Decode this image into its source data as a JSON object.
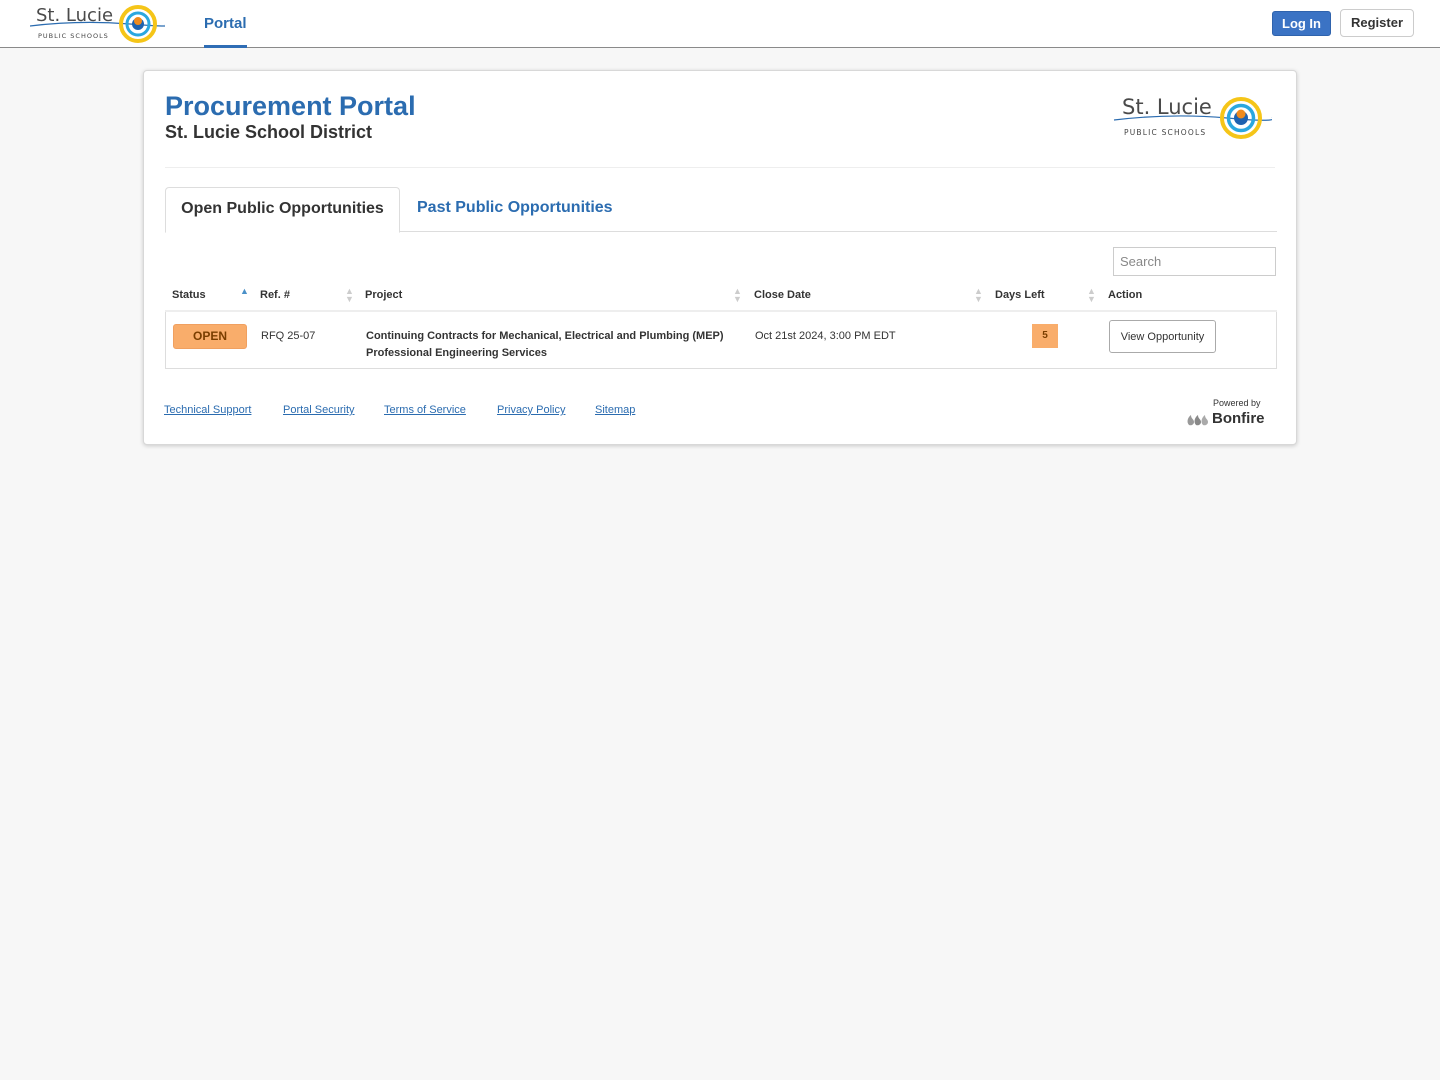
{
  "navbar": {
    "logo": {
      "name": "St. Lucie",
      "tagline": "PUBLIC SCHOOLS"
    },
    "tab_portal": "Portal",
    "login_label": "Log In",
    "register_label": "Register"
  },
  "header": {
    "title": "Procurement Portal",
    "subtitle": "St. Lucie School District",
    "logo": {
      "name": "St. Lucie",
      "tagline": "PUBLIC SCHOOLS"
    }
  },
  "tabs": [
    {
      "label": "Open Public Opportunities",
      "active": true
    },
    {
      "label": "Past Public Opportunities",
      "active": false
    }
  ],
  "search": {
    "placeholder": "Search",
    "value": ""
  },
  "table": {
    "columns": [
      "Status",
      "Ref. #",
      "Project",
      "Close Date",
      "Days Left",
      "Action"
    ],
    "sorted_column": "Status",
    "rows": [
      {
        "status": "OPEN",
        "ref": "RFQ 25-07",
        "project": "Continuing Contracts for Mechanical, Electrical and Plumbing (MEP) Professional Engineering Services",
        "close_date": "Oct 21st 2024, 3:00 PM EDT",
        "days_left": "5",
        "action": "View Opportunity"
      }
    ]
  },
  "footer": {
    "links": [
      "Technical Support",
      "Portal Security",
      "Terms of Service",
      "Privacy Policy",
      "Sitemap"
    ],
    "powered_by": "Powered by",
    "brand": "Bonfire"
  },
  "colors": {
    "accent": "#2b6cb0",
    "login_button": "#3b73c4",
    "status_open": "#f9ad6b"
  }
}
